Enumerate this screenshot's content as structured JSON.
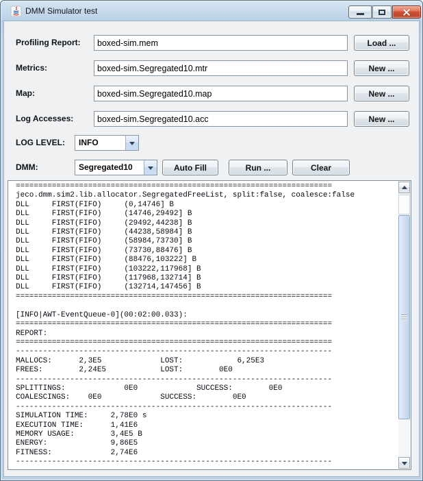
{
  "window": {
    "title": "DMM Simulator test"
  },
  "form": {
    "rows": [
      {
        "label": "Profiling Report:",
        "value": "boxed-sim.mem",
        "button": "Load ..."
      },
      {
        "label": "Metrics:",
        "value": "boxed-sim.Segregated10.mtr",
        "button": "New ..."
      },
      {
        "label": "Map:",
        "value": "boxed-sim.Segregated10.map",
        "button": "New ..."
      },
      {
        "label": "Log Accesses:",
        "value": "boxed-sim.Segregated10.acc",
        "button": "New ..."
      }
    ]
  },
  "log_level": {
    "label": "LOG LEVEL:",
    "value": "INFO"
  },
  "dmm": {
    "label": "DMM:",
    "value": "Segregated10",
    "buttons": {
      "autofill": "Auto Fill",
      "run": "Run ...",
      "clear": "Clear"
    }
  },
  "console": {
    "lines": [
      "======================================================================",
      "jeco.dmm.sim2.lib.allocator.SegregatedFreeList, split:false, coalesce:false",
      "DLL     FIRST(FIFO)     (0,14746] B",
      "DLL     FIRST(FIFO)     (14746,29492] B",
      "DLL     FIRST(FIFO)     (29492,44238] B",
      "DLL     FIRST(FIFO)     (44238,58984] B",
      "DLL     FIRST(FIFO)     (58984,73730] B",
      "DLL     FIRST(FIFO)     (73730,88476] B",
      "DLL     FIRST(FIFO)     (88476,103222] B",
      "DLL     FIRST(FIFO)     (103222,117968] B",
      "DLL     FIRST(FIFO)     (117968,132714] B",
      "DLL     FIRST(FIFO)     (132714,147456] B",
      "======================================================================",
      "",
      "[INFO|AWT-EventQueue-0](00:02:00.033):",
      "======================================================================",
      "REPORT:",
      "======================================================================",
      "----------------------------------------------------------------------",
      "MALLOCS:      2,3E5             LOST:            6,25E3",
      "FREES:        2,24E5            LOST:        0E0",
      "----------------------------------------------------------------------",
      "SPLITTINGS:             0E0             SUCCESS:        0E0",
      "COALESCINGS:    0E0             SUCCESS:        0E0",
      "----------------------------------------------------------------------",
      "SIMULATION TIME:     2,78E0 s",
      "EXECUTION TIME:      1,41E6",
      "MEMORY USAGE:        3,4E5 B",
      "ENERGY:              9,86E5",
      "FITNESS:             2,74E6",
      "----------------------------------------------------------------------"
    ]
  },
  "icons": {
    "java-icon": "java coffee cup logo",
    "minimize-icon": "—",
    "maximize-icon": "▢",
    "close-icon": "✕",
    "combo-arrow-icon": "▼",
    "scroll-up-icon": "▲",
    "scroll-down-icon": "▼",
    "thumb-grip-icon": "≡"
  },
  "colors": {
    "titlebar_blue": "#bdd3e8",
    "close_button_red": "#cd5136",
    "content_background": "#f0f1f3",
    "console_background": "#ffffff",
    "scrollbar_thumb_blue": "#c9daf0",
    "combo_arrow_blue": "#cfdff2"
  }
}
